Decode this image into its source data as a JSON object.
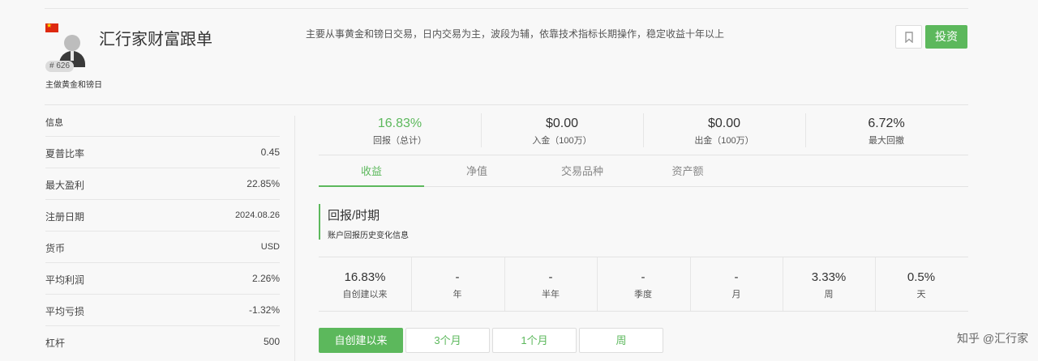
{
  "header": {
    "title": "汇行家财富跟单",
    "rank": "# 626",
    "subtitle": "主做黄金和镑日",
    "description": "主要从事黄金和镑日交易，日内交易为主，波段为辅，依靠技术指标长期操作，稳定收益十年以上",
    "invest_label": "投资",
    "flag_color": "#de2910",
    "icons": [
      "china-flag-icon",
      "user-avatar-icon",
      "bookmark-icon"
    ]
  },
  "info": {
    "title": "信息",
    "rows": [
      {
        "key": "夏普比率",
        "value": "0.45"
      },
      {
        "key": "最大盈利",
        "value": "22.85%"
      },
      {
        "key": "注册日期",
        "value": "2024.08.26"
      },
      {
        "key": "货币",
        "value": "USD"
      },
      {
        "key": "平均利润",
        "value": "2.26%"
      },
      {
        "key": "平均亏损",
        "value": "-1.32%"
      },
      {
        "key": "杠杆",
        "value": "500"
      }
    ]
  },
  "stats": [
    {
      "value": "16.83%",
      "label": "回报（总计）"
    },
    {
      "value": "$0.00",
      "label": "入金（100万）"
    },
    {
      "value": "$0.00",
      "label": "出金（100万）"
    },
    {
      "value": "6.72%",
      "label": "最大回撤"
    }
  ],
  "tabs": [
    {
      "label": "收益",
      "active": true
    },
    {
      "label": "净值",
      "active": false
    },
    {
      "label": "交易品种",
      "active": false
    },
    {
      "label": "资产额",
      "active": false
    }
  ],
  "section": {
    "heading": "回报/时期",
    "subheading": "账户回报历史变化信息"
  },
  "periods": [
    {
      "value": "16.83%",
      "label": "自创建以来"
    },
    {
      "value": "-",
      "label": "年"
    },
    {
      "value": "-",
      "label": "半年"
    },
    {
      "value": "-",
      "label": "季度"
    },
    {
      "value": "-",
      "label": "月"
    },
    {
      "value": "3.33%",
      "label": "周"
    },
    {
      "value": "0.5%",
      "label": "天"
    }
  ],
  "ranges": [
    {
      "label": "自创建以来",
      "active": true
    },
    {
      "label": "3个月",
      "active": false
    },
    {
      "label": "1个月",
      "active": false
    },
    {
      "label": "周",
      "active": false
    }
  ],
  "colors": {
    "accent": "#5cb85c"
  },
  "watermark": "知乎 @汇行家"
}
